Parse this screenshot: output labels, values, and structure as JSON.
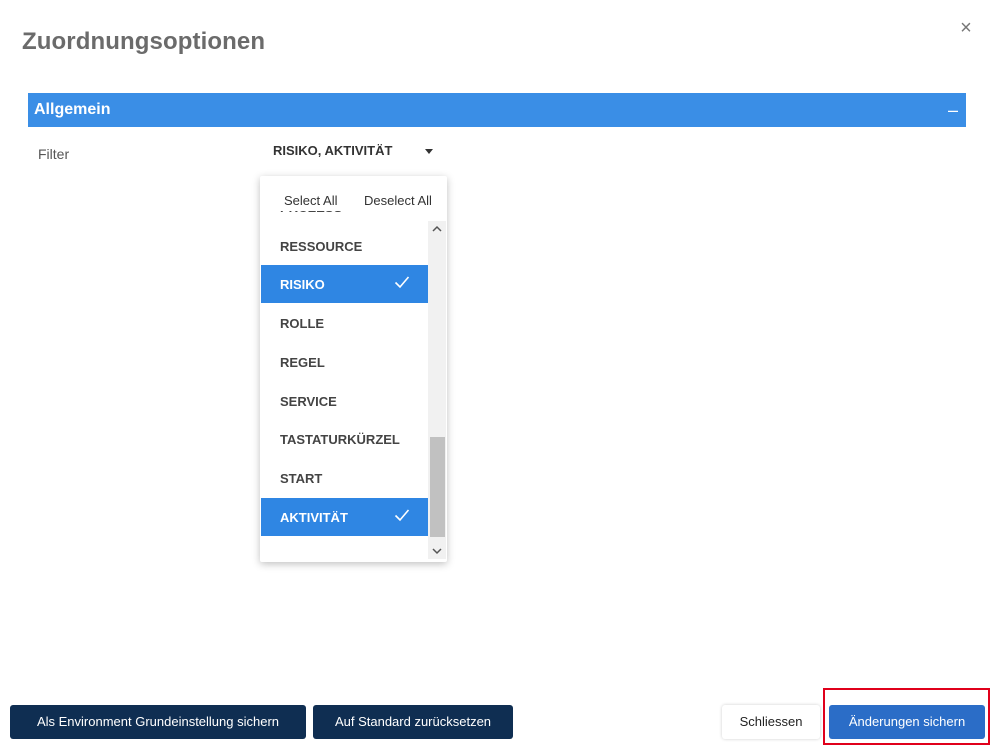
{
  "dialog": {
    "title": "Zuordnungsoptionen",
    "close_symbol": "×"
  },
  "section": {
    "title": "Allgemein",
    "collapse_symbol": "–"
  },
  "filter": {
    "label": "Filter",
    "value": "RISIKO, AKTIVITÄT",
    "dropdown": {
      "select_all": "Select All",
      "deselect_all": "Deselect All",
      "options": [
        {
          "label": "PROZESS",
          "selected": false
        },
        {
          "label": "RESSOURCE",
          "selected": false
        },
        {
          "label": "RISIKO",
          "selected": true
        },
        {
          "label": "ROLLE",
          "selected": false
        },
        {
          "label": "REGEL",
          "selected": false
        },
        {
          "label": "SERVICE",
          "selected": false
        },
        {
          "label": "TASTATURKÜRZEL",
          "selected": false
        },
        {
          "label": "START",
          "selected": false
        },
        {
          "label": "AKTIVITÄT",
          "selected": true
        }
      ]
    }
  },
  "footer": {
    "env_default_label": "Als Environment Grundeinstellung sichern",
    "reset_label": "Auf Standard zurücksetzen",
    "close_label": "Schliessen",
    "save_label": "Änderungen sichern"
  },
  "colors": {
    "section_header": "#3a8ee6",
    "selected_option": "#2f86e3",
    "dark_button": "#0f2e52",
    "primary_button": "#2b6dc7",
    "highlight": "#e0001b"
  }
}
